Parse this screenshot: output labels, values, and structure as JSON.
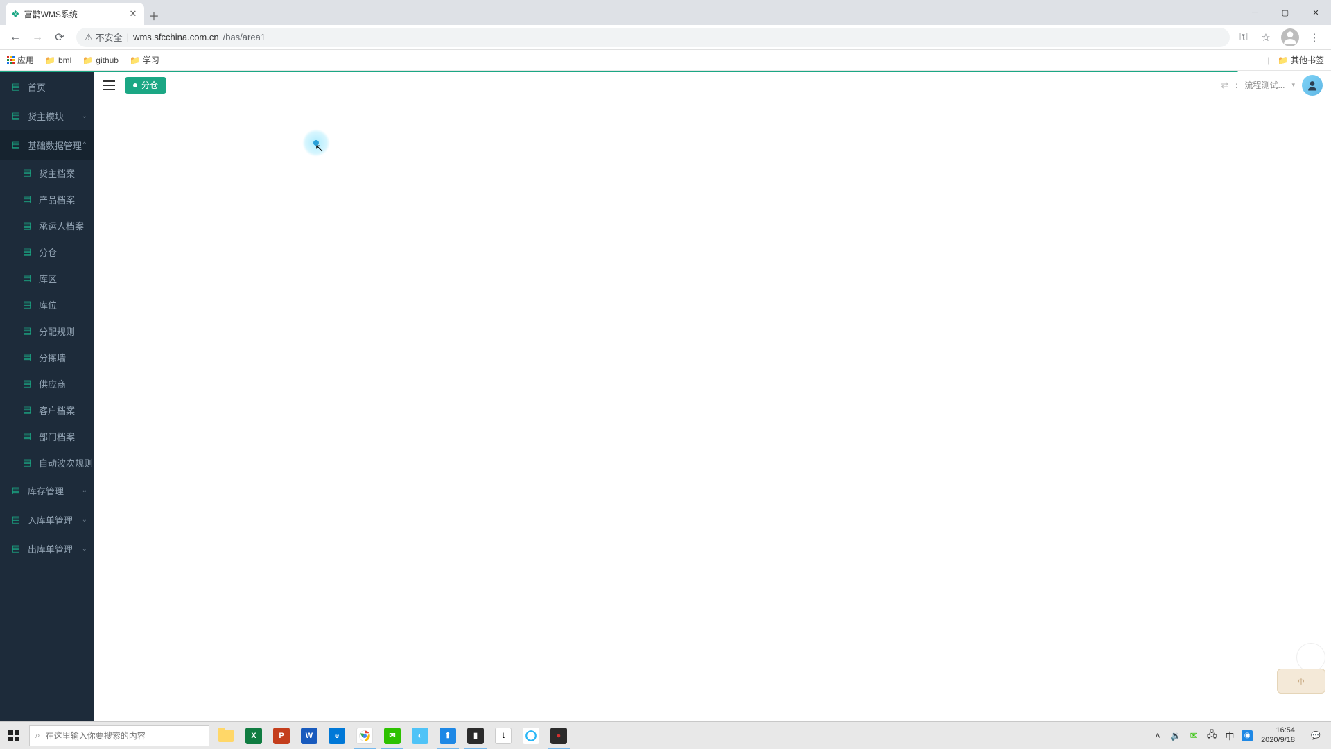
{
  "browser": {
    "tab_title": "富鹊WMS系统",
    "security_label": "不安全",
    "url_host": "wms.sfcchina.com.cn",
    "url_path": "/bas/area1"
  },
  "bookmarks": {
    "apps": "应用",
    "items": [
      "bml",
      "github",
      "学习"
    ],
    "other": "其他书签"
  },
  "sidebar": {
    "home": "首页",
    "owner_module": "货主模块",
    "base_data": "基础数据管理",
    "subs": {
      "owner_archive": "货主档案",
      "product_archive": "产品档案",
      "carrier_archive": "承运人档案",
      "warehouse": "分仓",
      "zone": "库区",
      "location": "库位",
      "alloc_rule": "分配规则",
      "sort_wall": "分拣墙",
      "supplier": "供应商",
      "customer_archive": "客户档案",
      "dept_archive": "部门档案",
      "auto_wave_rule": "自动波次规则"
    },
    "inv_mgmt": "库存管理",
    "inbound_mgmt": "入库单管理",
    "outbound_mgmt": "出库单管理"
  },
  "topbar": {
    "tag": "分仓",
    "user_label": "流程测试..."
  },
  "taskbar": {
    "search_placeholder": "在这里输入你要搜索的内容",
    "time": "16:54",
    "date": "2020/9/18",
    "ime_widget": "中"
  }
}
